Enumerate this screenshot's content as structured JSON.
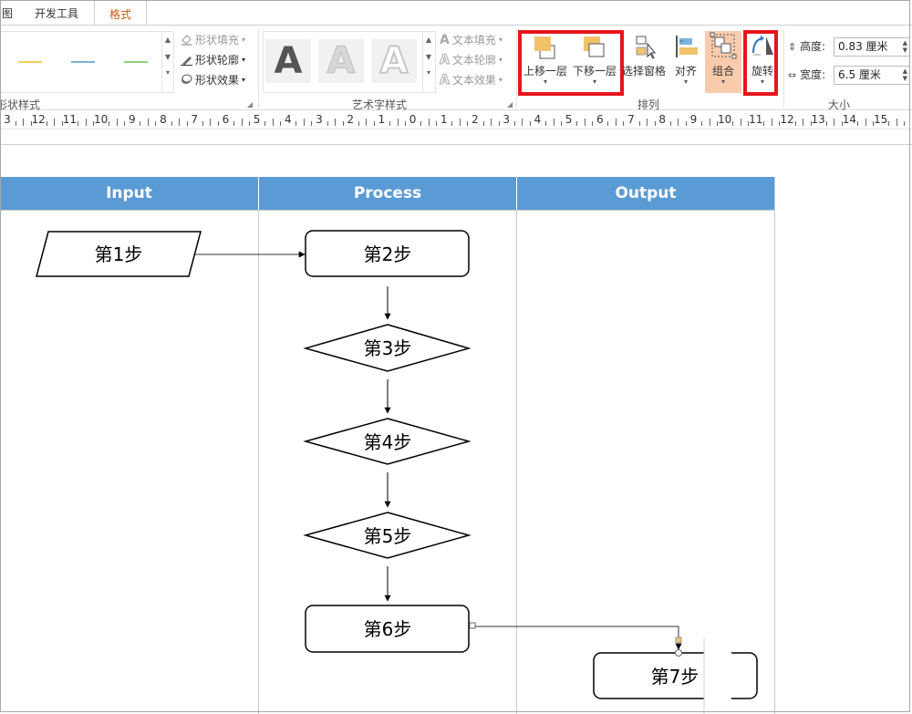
{
  "tabs": [
    {
      "label": "图",
      "active": false
    },
    {
      "label": "开发工具",
      "active": false
    },
    {
      "label": "格式",
      "active": true
    }
  ],
  "ribbon": {
    "shape_styles": {
      "label": "形状样式",
      "swatch_colors": [
        "#f2d05b",
        "#7cb4d9",
        "#8fd07c"
      ],
      "commands": [
        "形状填充",
        "形状轮廓",
        "形状效果"
      ]
    },
    "wordart": {
      "label": "艺术字样式",
      "letter": "A",
      "commands": [
        "文本填充",
        "文本轮廓",
        "文本效果"
      ]
    },
    "arrange": {
      "label": "排列",
      "bring_forward": "上移一层",
      "send_backward": "下移一层",
      "selection_pane": "选择窗格",
      "align": "对齐",
      "group": "组合",
      "rotate": "旋转"
    },
    "size": {
      "label": "大小",
      "height_label": "高度:",
      "height_value": "0.83 厘米",
      "width_label": "宽度:",
      "width_value": "6.5 厘米"
    }
  },
  "ruler": {
    "labels": [
      "3",
      "12",
      "11",
      "10",
      "9",
      "8",
      "7",
      "6",
      "5",
      "4",
      "3",
      "2",
      "1",
      "0",
      "1",
      "2",
      "3",
      "4",
      "5",
      "6",
      "7",
      "8",
      "9",
      "10",
      "11",
      "12",
      "13",
      "14",
      "15"
    ]
  },
  "flowchart": {
    "lanes": [
      "Input",
      "Process",
      "Output"
    ],
    "steps": [
      "第1步",
      "第2步",
      "第3步",
      "第4步",
      "第5步",
      "第6步",
      "第7步"
    ]
  },
  "colors": {
    "accent_tab": "#c55a11",
    "swimlane_header": "#5b9bd5",
    "highlight_box": "#e8141b",
    "group_button_bg": "#f8cbad",
    "layer_icon": "#f0c36b"
  }
}
